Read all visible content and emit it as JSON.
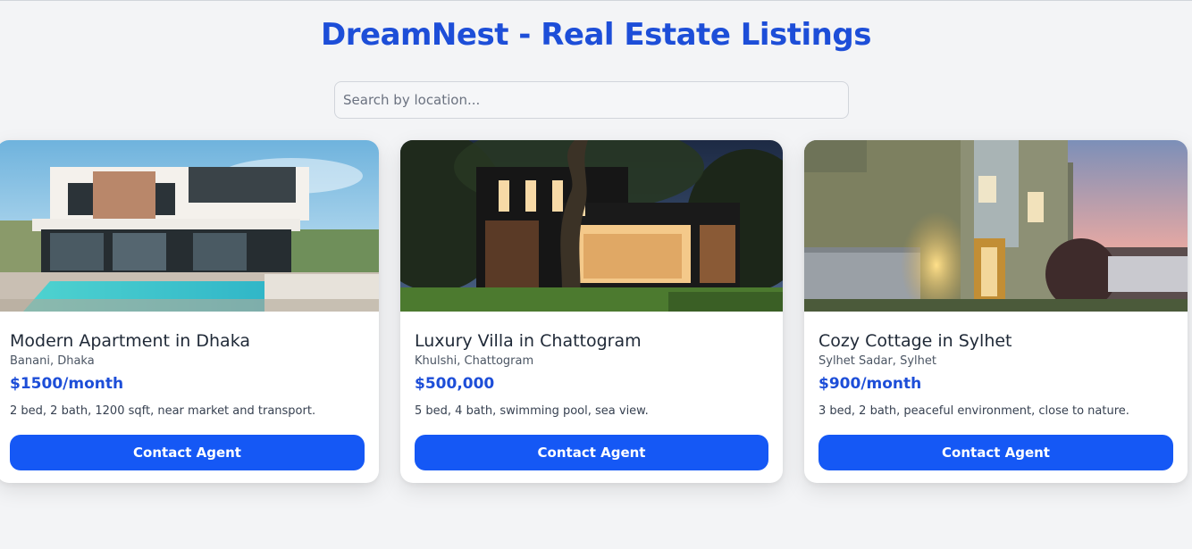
{
  "header": {
    "title": "DreamNest - Real Estate Listings"
  },
  "search": {
    "placeholder": "Search by location...",
    "value": ""
  },
  "listings": [
    {
      "title": "Modern Apartment in Dhaka",
      "location": "Banani, Dhaka",
      "price": "$1500/month",
      "description": "2 bed, 2 bath, 1200 sqft, near market and transport.",
      "button_label": "Contact Agent"
    },
    {
      "title": "Luxury Villa in Chattogram",
      "location": "Khulshi, Chattogram",
      "price": "$500,000",
      "description": "5 bed, 4 bath, swimming pool, sea view.",
      "button_label": "Contact Agent"
    },
    {
      "title": "Cozy Cottage in Sylhet",
      "location": "Sylhet Sadar, Sylhet",
      "price": "$900/month",
      "description": "3 bed, 2 bath, peaceful environment, close to nature.",
      "button_label": "Contact Agent"
    }
  ],
  "colors": {
    "accent": "#1d4ed8",
    "button": "#1558f5",
    "background": "#f3f4f6"
  }
}
